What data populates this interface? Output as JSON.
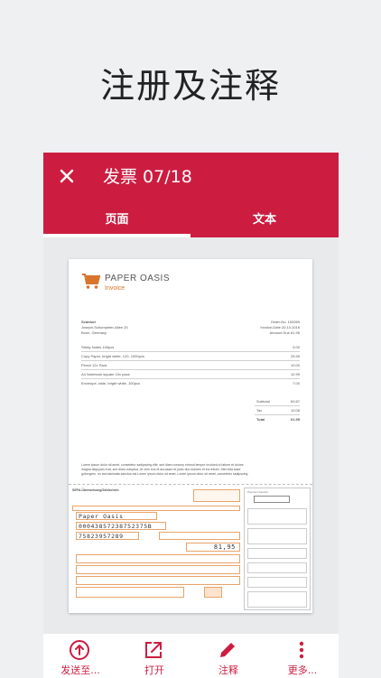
{
  "headline": "注册及注释",
  "appbar": {
    "title": "发票 07/18",
    "close_icon": "close-icon"
  },
  "tabs": [
    {
      "label": "页面",
      "active": true
    },
    {
      "label": "文本",
      "active": false
    }
  ],
  "document": {
    "company": "PAPER OASIS",
    "doc_type": "Invoice",
    "customer_lines": [
      "Scanbot",
      "Joseph-Schumpeter-Allee 25",
      "Bonn, Germany"
    ],
    "meta_lines": [
      "Order-No. 153269",
      "Invoice-Date 20.10.2016",
      "Amount Due 61.95"
    ],
    "items": [
      {
        "name": "Sticky Notes 100pcs",
        "price": "5.00"
      },
      {
        "name": "Copy Paper, bright white, 120, 1000pcs",
        "price": "25.99"
      },
      {
        "name": "Pencil 12x Pack",
        "price": "10.00"
      },
      {
        "name": "A4 Notebook square 10x pack",
        "price": "12.99"
      },
      {
        "name": "Envelope, wide, bright white, 100pcs",
        "price": "7.00"
      }
    ],
    "totals": [
      {
        "label": "Subtotal",
        "value": "60.67"
      },
      {
        "label": "Tax",
        "value": "10.08"
      },
      {
        "label": "Total",
        "value": "61.95"
      }
    ],
    "footer_text": [
      "Lorem ipsum dolor sit amet, consetetur sadipscing elitr, sed diam nonumy eirmod tempor invidunt ut labore et dolore",
      "magna aliquyam erat, sed diam voluptua. At vero eos et accusam et justo duo dolores et ea rebum. Stet clita kasd",
      "gubergren, no sea takimata sanctus est Lorem ipsum dolor sit amet. Lorem ipsum dolor sit amet, consetetur sadipscing"
    ],
    "form": {
      "title": "SEPA-Überweisung/Zahlschein",
      "receiver_name": "Paper Oasis",
      "iban": "00043857238752375B",
      "bic": "75823957289",
      "amount": "81,95",
      "receipt_title": "Payment Receipt"
    }
  },
  "bottom_actions": [
    {
      "label": "发送至...",
      "icon": "share-arrow-icon"
    },
    {
      "label": "打开",
      "icon": "open-external-icon"
    },
    {
      "label": "注释",
      "icon": "pencil-icon"
    },
    {
      "label": "更多...",
      "icon": "more-vertical-icon"
    }
  ],
  "colors": {
    "accent": "#cc1d40",
    "logo": "#d8742c",
    "form": "#e07a2c",
    "background": "#eef0f2"
  }
}
